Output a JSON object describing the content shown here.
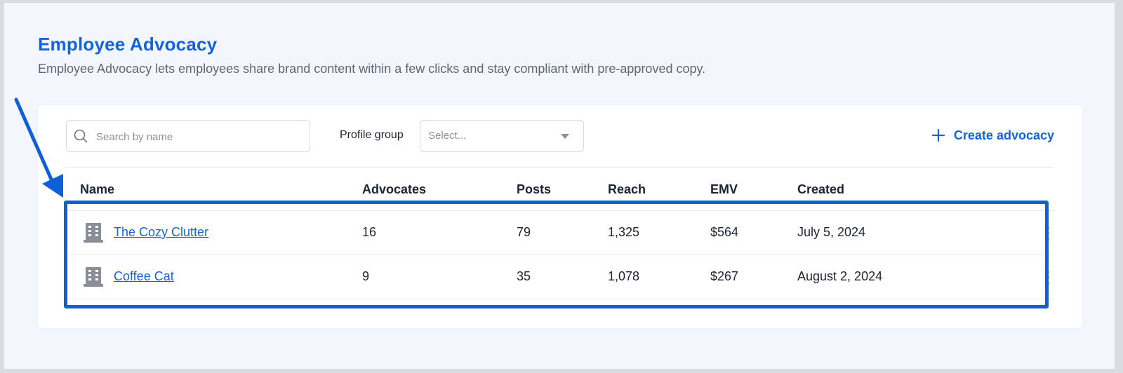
{
  "header": {
    "title": "Employee Advocacy",
    "subtitle": "Employee Advocacy lets employees share brand content within a few clicks and stay compliant with pre-approved copy."
  },
  "toolbar": {
    "search_placeholder": "Search by name",
    "search_value": "",
    "profile_group_label": "Profile group",
    "profile_group_select": "Select...",
    "create_label": "Create advocacy"
  },
  "table": {
    "columns": [
      "Name",
      "Advocates",
      "Posts",
      "Reach",
      "EMV",
      "Created"
    ],
    "rows": [
      {
        "name": "The Cozy Clutter",
        "advocates": "16",
        "posts": "79",
        "reach": "1,325",
        "emv": "$564",
        "created": "July 5, 2024"
      },
      {
        "name": "Coffee Cat",
        "advocates": "9",
        "posts": "35",
        "reach": "1,078",
        "emv": "$267",
        "created": "August 2, 2024"
      }
    ]
  },
  "icons": {
    "search": "search-icon",
    "dropdown": "chevron-down-icon",
    "create": "plus-icon",
    "row": "building-icon",
    "row_menu": "kebab-menu-icon",
    "annotation": "arrow-icon"
  },
  "colors": {
    "accent": "#1463d8",
    "highlight": "#0f5fd8",
    "text": "#1c2433",
    "muted": "#5f6673"
  }
}
